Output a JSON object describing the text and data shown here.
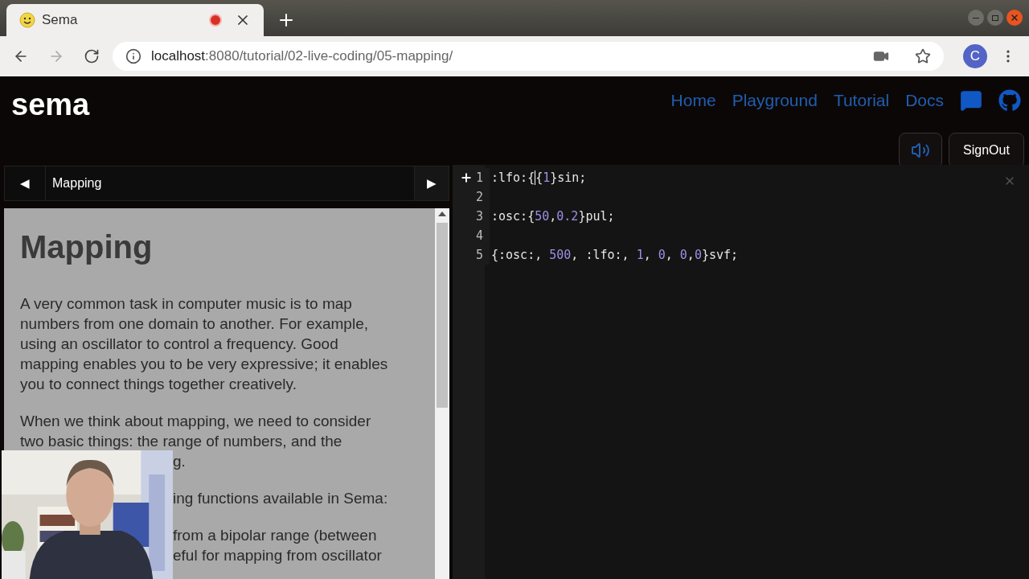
{
  "browser": {
    "tab": {
      "title": "Sema",
      "recording": true
    },
    "url": {
      "host": "localhost",
      "path": ":8080/tutorial/02-live-coding/05-mapping/"
    },
    "profile": "C"
  },
  "app": {
    "logo": "sema",
    "nav": [
      "Home",
      "Playground",
      "Tutorial",
      "Docs"
    ],
    "sound_on": true,
    "signout": "SignOut"
  },
  "tutorial": {
    "prev": "◀",
    "title": "Mapping",
    "next": "▶",
    "heading": "Mapping",
    "blocks": [
      {
        "kind": "paragraph",
        "text": "A very common task in computer music is to map numbers from one domain to another. For example, using an oscillator to control a frequency. Good mapping enables you to be very expressive; it enables you to connect things together creatively."
      },
      {
        "kind": "paragraph",
        "text": "When we think about mapping, we need to consider two basic things: the range of numbers, and the",
        "fragments": [
          "g."
        ]
      },
      {
        "kind": "partial",
        "lines": [
          "ing functions available in Sema:"
        ]
      },
      {
        "kind": "partial",
        "lines": [
          "from a bipolar range (between",
          "eful for mapping from oscillator"
        ]
      }
    ]
  },
  "editor": {
    "lines": [
      {
        "number": "1",
        "folded": true,
        "tokens": [
          {
            "kind": "text",
            "text": ":lfo:{"
          },
          {
            "kind": "cursor"
          },
          {
            "kind": "text",
            "text": "{"
          },
          {
            "kind": "number",
            "text": "1"
          },
          {
            "kind": "text",
            "text": "}sin;"
          }
        ]
      },
      {
        "number": "2",
        "folded": false
      },
      {
        "number": "3",
        "folded": false,
        "tokens": [
          {
            "kind": "text",
            "text": ":osc:{"
          },
          {
            "kind": "number",
            "text": "50"
          },
          {
            "kind": "text",
            "text": ","
          },
          {
            "kind": "number",
            "text": "0.2"
          },
          {
            "kind": "text",
            "text": "}pul;"
          }
        ]
      },
      {
        "number": "4",
        "folded": false
      },
      {
        "number": "5",
        "folded": false,
        "tokens": [
          {
            "kind": "text",
            "text": "{:osc:, "
          },
          {
            "kind": "number",
            "text": "500"
          },
          {
            "kind": "text",
            "text": ", :lfo:, "
          },
          {
            "kind": "number",
            "text": "1"
          },
          {
            "kind": "text",
            "text": ", "
          },
          {
            "kind": "number",
            "text": "0"
          },
          {
            "kind": "text",
            "text": ", "
          },
          {
            "kind": "number",
            "text": "0"
          },
          {
            "kind": "text",
            "text": ","
          },
          {
            "kind": "number",
            "text": "0"
          },
          {
            "kind": "text",
            "text": "}svf;"
          }
        ]
      }
    ]
  }
}
